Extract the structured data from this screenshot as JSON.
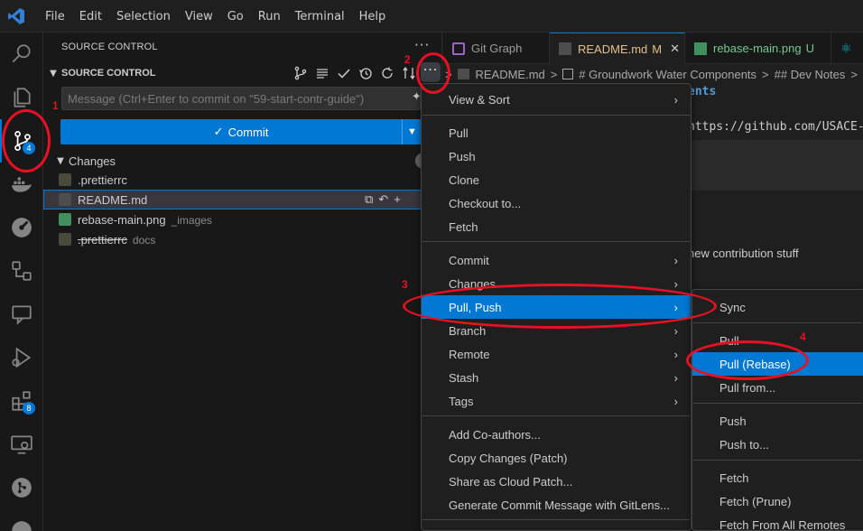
{
  "menubar": [
    "File",
    "Edit",
    "Selection",
    "View",
    "Go",
    "Run",
    "Terminal",
    "Help"
  ],
  "activity": {
    "scm_badge": "4",
    "extensions_badge": "8"
  },
  "sidebar": {
    "title": "SOURCE CONTROL",
    "section_title": "SOURCE CONTROL",
    "more_label": "···",
    "commit_placeholder": "Message (Ctrl+Enter to commit on \"59-start-contr-guide\")",
    "commit_label": "Commit",
    "changes_label": "Changes",
    "files": [
      {
        "name": ".prettierrc",
        "dir": "",
        "deleted": false
      },
      {
        "name": "README.md",
        "dir": "",
        "deleted": false
      },
      {
        "name": "rebase-main.png",
        "dir": "_images",
        "deleted": false
      },
      {
        "name": ".prettierrc",
        "dir": "docs",
        "deleted": true
      }
    ]
  },
  "tabs": [
    {
      "label": "Git Graph",
      "badge": ""
    },
    {
      "label": "README.md",
      "badge": "M"
    },
    {
      "label": "rebase-main.png",
      "badge": "U"
    }
  ],
  "breadcrumb": [
    "README.md",
    ">",
    "# Groundwork Water Components",
    ">",
    "## Dev Notes",
    ">"
  ],
  "editor": {
    "line1": "ents",
    "line2": "https://github.com/USACE-W",
    "line3": "new contribution stuff"
  },
  "menu": {
    "items": [
      {
        "label": "View & Sort",
        "submenu": true
      },
      {
        "label": "Pull",
        "submenu": false
      },
      {
        "label": "Push",
        "submenu": false
      },
      {
        "label": "Clone",
        "submenu": false
      },
      {
        "label": "Checkout to...",
        "submenu": false
      },
      {
        "label": "Fetch",
        "submenu": false
      },
      {
        "label": "Commit",
        "submenu": true
      },
      {
        "label": "Changes",
        "submenu": true
      },
      {
        "label": "Pull, Push",
        "submenu": true
      },
      {
        "label": "Branch",
        "submenu": true
      },
      {
        "label": "Remote",
        "submenu": true
      },
      {
        "label": "Stash",
        "submenu": true
      },
      {
        "label": "Tags",
        "submenu": true
      },
      {
        "label": "Add Co-authors...",
        "submenu": false
      },
      {
        "label": "Copy Changes (Patch)",
        "submenu": false
      },
      {
        "label": "Share as Cloud Patch...",
        "submenu": false
      },
      {
        "label": "Generate Commit Message with GitLens...",
        "submenu": false
      }
    ]
  },
  "submenu": {
    "items": [
      "Sync",
      "Pull",
      "Pull (Rebase)",
      "Pull from...",
      "Push",
      "Push to...",
      "Fetch",
      "Fetch (Prune)",
      "Fetch From All Remotes"
    ]
  },
  "annotations": [
    "1",
    "2",
    "3",
    "4"
  ],
  "colors": {
    "accent": "#0078d4",
    "annotation": "#e81123",
    "modified": "#e2c08d",
    "untracked": "#73c991"
  }
}
